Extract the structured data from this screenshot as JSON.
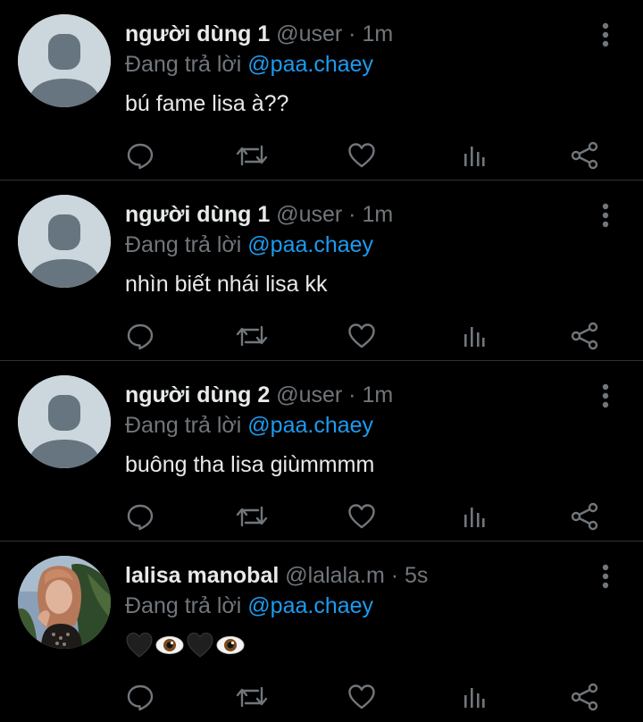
{
  "colors": {
    "background": "#000000",
    "primary_text": "#e7e9ea",
    "secondary_text": "#71767b",
    "mention": "#1d9bf0",
    "divider": "#2f3336"
  },
  "icons": {
    "reply": "speech-bubble",
    "retweet": "retweet-arrows",
    "like": "heart-outline",
    "views": "bar-chart",
    "share": "share-nodes",
    "more": "vertical-ellipsis"
  },
  "tweets": [
    {
      "name": "người dùng 1",
      "handle": "@user",
      "dot": "·",
      "time": "1m",
      "reply_prefix": "Đang trả lời",
      "reply_to": "@paa.chaey",
      "text": "bú fame lisa à??",
      "avatar": "default"
    },
    {
      "name": "người dùng 1",
      "handle": "@user",
      "dot": "·",
      "time": "1m",
      "reply_prefix": "Đang trả lời",
      "reply_to": "@paa.chaey",
      "text": "nhìn biết nhái lisa kk",
      "avatar": "default"
    },
    {
      "name": "người dùng 2",
      "handle": "@user",
      "dot": "·",
      "time": "1m",
      "reply_prefix": "Đang trả lời",
      "reply_to": "@paa.chaey",
      "text": "buông tha lisa giùmmmm",
      "avatar": "default"
    },
    {
      "name": "lalisa manobal",
      "handle": "@lalala.m",
      "dot": "·",
      "time": "5s",
      "reply_prefix": "Đang trả lời",
      "reply_to": "@paa.chaey",
      "emojis": [
        "black-heart",
        "eye",
        "black-heart",
        "eye"
      ],
      "avatar": "photo"
    }
  ]
}
